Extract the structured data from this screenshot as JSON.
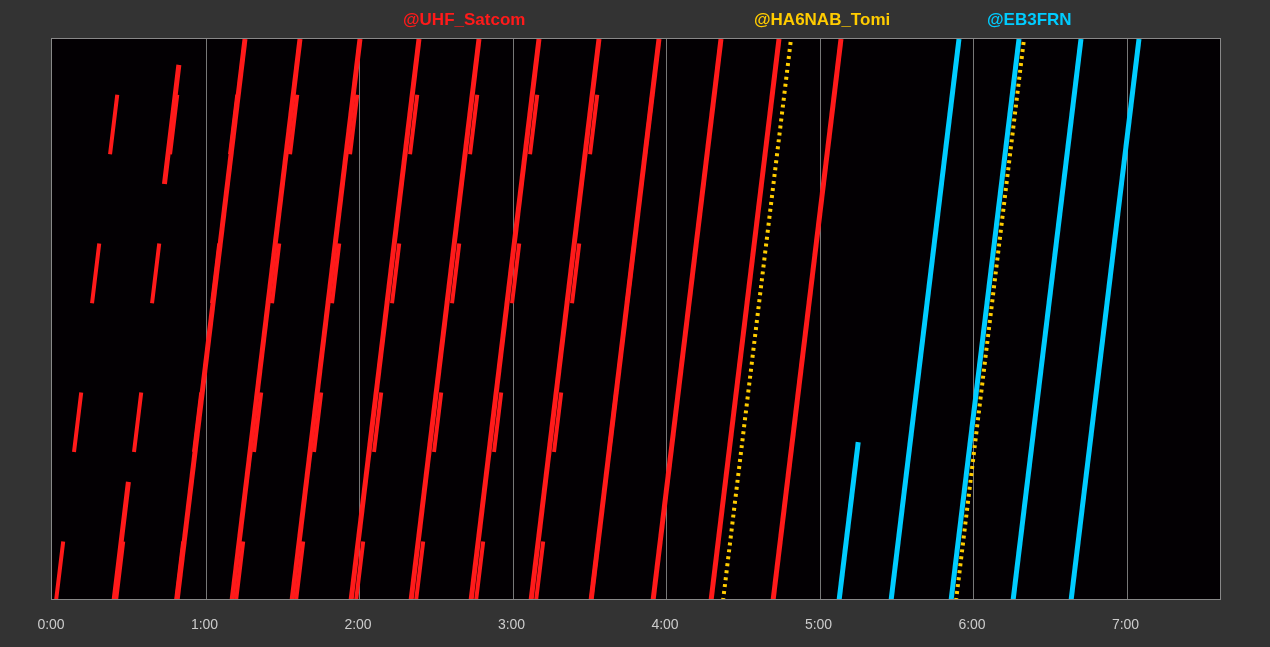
{
  "legend": [
    {
      "label": "@UHF_Satcom",
      "color": "#ff1a1a"
    },
    {
      "label": "@HA6NAB_Tomi",
      "color": "#ffcc00"
    },
    {
      "label": "@EB3FRN",
      "color": "#00ccff"
    }
  ],
  "x_ticks": [
    "0:00",
    "1:00",
    "2:00",
    "3:00",
    "4:00",
    "5:00",
    "6:00",
    "7:00"
  ]
}
